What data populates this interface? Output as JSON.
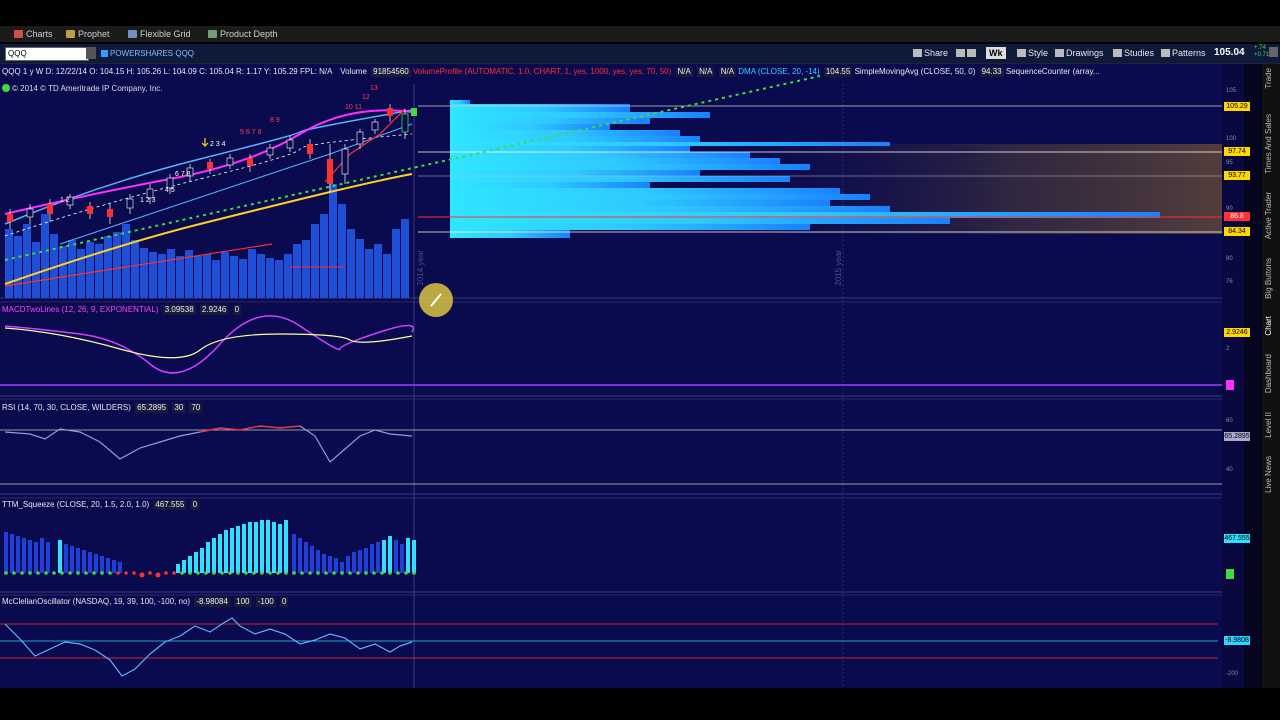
{
  "tabs": [
    {
      "label": "Charts"
    },
    {
      "label": "Prophet"
    },
    {
      "label": "Flexible Grid"
    },
    {
      "label": "Product Depth"
    }
  ],
  "toolbar": {
    "symbol": "QQQ",
    "description": "POWERSHARES QQQ",
    "share": "Share",
    "aggregation": "Wk",
    "style": "Style",
    "drawings": "Drawings",
    "studies": "Studies",
    "patterns": "Patterns",
    "last_price": "105.04",
    "change_top": "+.74",
    "change_bottom": "+0.71%"
  },
  "header": {
    "period": "QQQ 1 y W",
    "date": "D: 12/22/14",
    "open": "O: 104.15",
    "high": "H: 105.26",
    "low": "L: 104.09",
    "close": "C: 105.04",
    "range": "R: 1.17",
    "y": "Y: 105.29",
    "fpl": "FPL: N/A",
    "volume_label": "Volume",
    "volume_value": "91854560",
    "vp_label": "VolumeProfile (AUTOMATIC, 1.0, CHART, 1, yes, 1000, yes, yes, 70, 50)",
    "na1": "N/A",
    "na2": "N/A",
    "na3": "N/A",
    "dma": "DMA (CLOSE, 20, -14)",
    "dma_val": "104.55",
    "sma": "SimpleMovingAvg (CLOSE, 50, 0)",
    "sma_val": "94.33",
    "seq": "SequenceCounter (array..."
  },
  "copyright": "© 2014 © TD Ameritrade IP Company, Inc.",
  "year_labels": {
    "y2014": "2014 year",
    "y2015": "2015 year"
  },
  "price_boxes": [
    {
      "value": "105.29",
      "color": "#ffd700"
    },
    {
      "value": "97.74",
      "color": "#ffd700"
    },
    {
      "value": "93.77",
      "color": "#ffd700"
    },
    {
      "value": "86.8",
      "color": "#ff3030"
    },
    {
      "value": "84.34",
      "color": "#ffd700"
    }
  ],
  "price_ticks": [
    "105",
    "100",
    "95",
    "90",
    "85",
    "80",
    "76"
  ],
  "macd": {
    "label": "MACDTwoLines (12, 26, 9, EXPONENTIAL)",
    "v1": "3.09538",
    "v2": "2.9246",
    "v3": "0",
    "box": "2.9246",
    "tick": "2"
  },
  "rsi": {
    "label": "RSI (14, 70, 30, CLOSE, WILDERS)",
    "v1": "65.2895",
    "v2": "30",
    "v3": "70",
    "box": "65.2895",
    "t1": "60",
    "t2": "40"
  },
  "squeeze": {
    "label": "TTM_Squeeze (CLOSE, 20, 1.5, 2.0, 1.0)",
    "v1": "467.555",
    "v2": "0",
    "box": "467.555"
  },
  "mcclellan": {
    "label": "McClellanOscillator (NASDAQ, 19, 39, 100, -100, no)",
    "v1": "-8.98084",
    "v2": "100",
    "v3": "-100",
    "v4": "0",
    "box": "-8.9808",
    "tick": "-200"
  },
  "sidebar": [
    "Trade",
    "Times And Sales",
    "Active Trader",
    "Big Buttons",
    "Chart",
    "Dashboard",
    "Level II",
    "Live News"
  ],
  "colors": {
    "background": "#0a0a4e",
    "accent": "#2fd6ff",
    "up": "#3fdc3f",
    "down": "#ff3030"
  }
}
